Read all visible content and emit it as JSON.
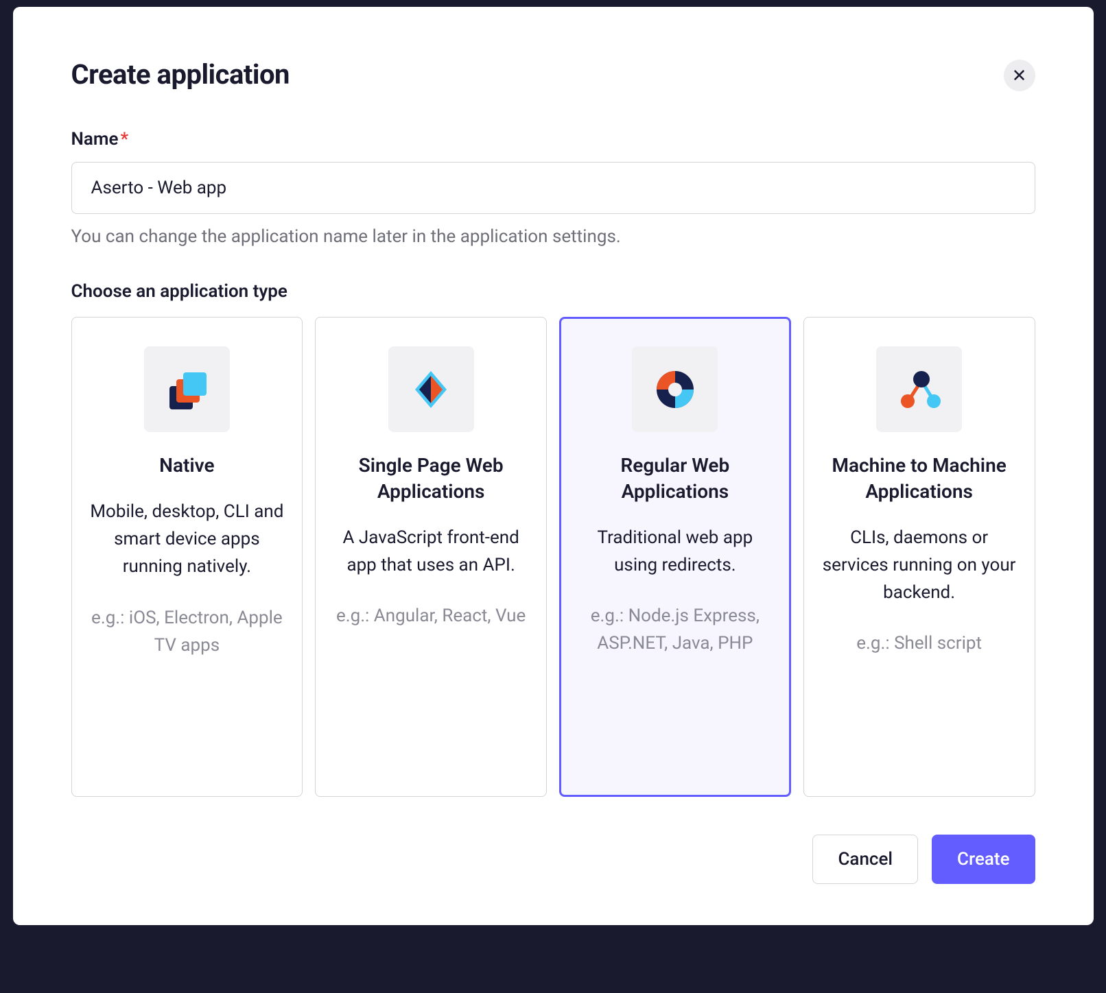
{
  "modal": {
    "title": "Create application",
    "close_label": "✕"
  },
  "name_field": {
    "label": "Name",
    "required": "*",
    "value": "Aserto - Web app",
    "help": "You can change the application name later in the application settings."
  },
  "type_section": {
    "label": "Choose an application type",
    "selected": "regular",
    "options": [
      {
        "id": "native",
        "title": "Native",
        "description": "Mobile, desktop, CLI and smart device apps running natively.",
        "example": "e.g.: iOS, Electron, Apple TV apps"
      },
      {
        "id": "spa",
        "title": "Single Page Web Applications",
        "description": "A JavaScript front-end app that uses an API.",
        "example": "e.g.: Angular, React, Vue"
      },
      {
        "id": "regular",
        "title": "Regular Web Applications",
        "description": "Traditional web app using redirects.",
        "example": "e.g.: Node.js Express, ASP.NET, Java, PHP"
      },
      {
        "id": "m2m",
        "title": "Machine to Machine Applications",
        "description": "CLIs, daemons or services running on your backend.",
        "example": "e.g.: Shell script"
      }
    ]
  },
  "actions": {
    "cancel": "Cancel",
    "create": "Create"
  }
}
